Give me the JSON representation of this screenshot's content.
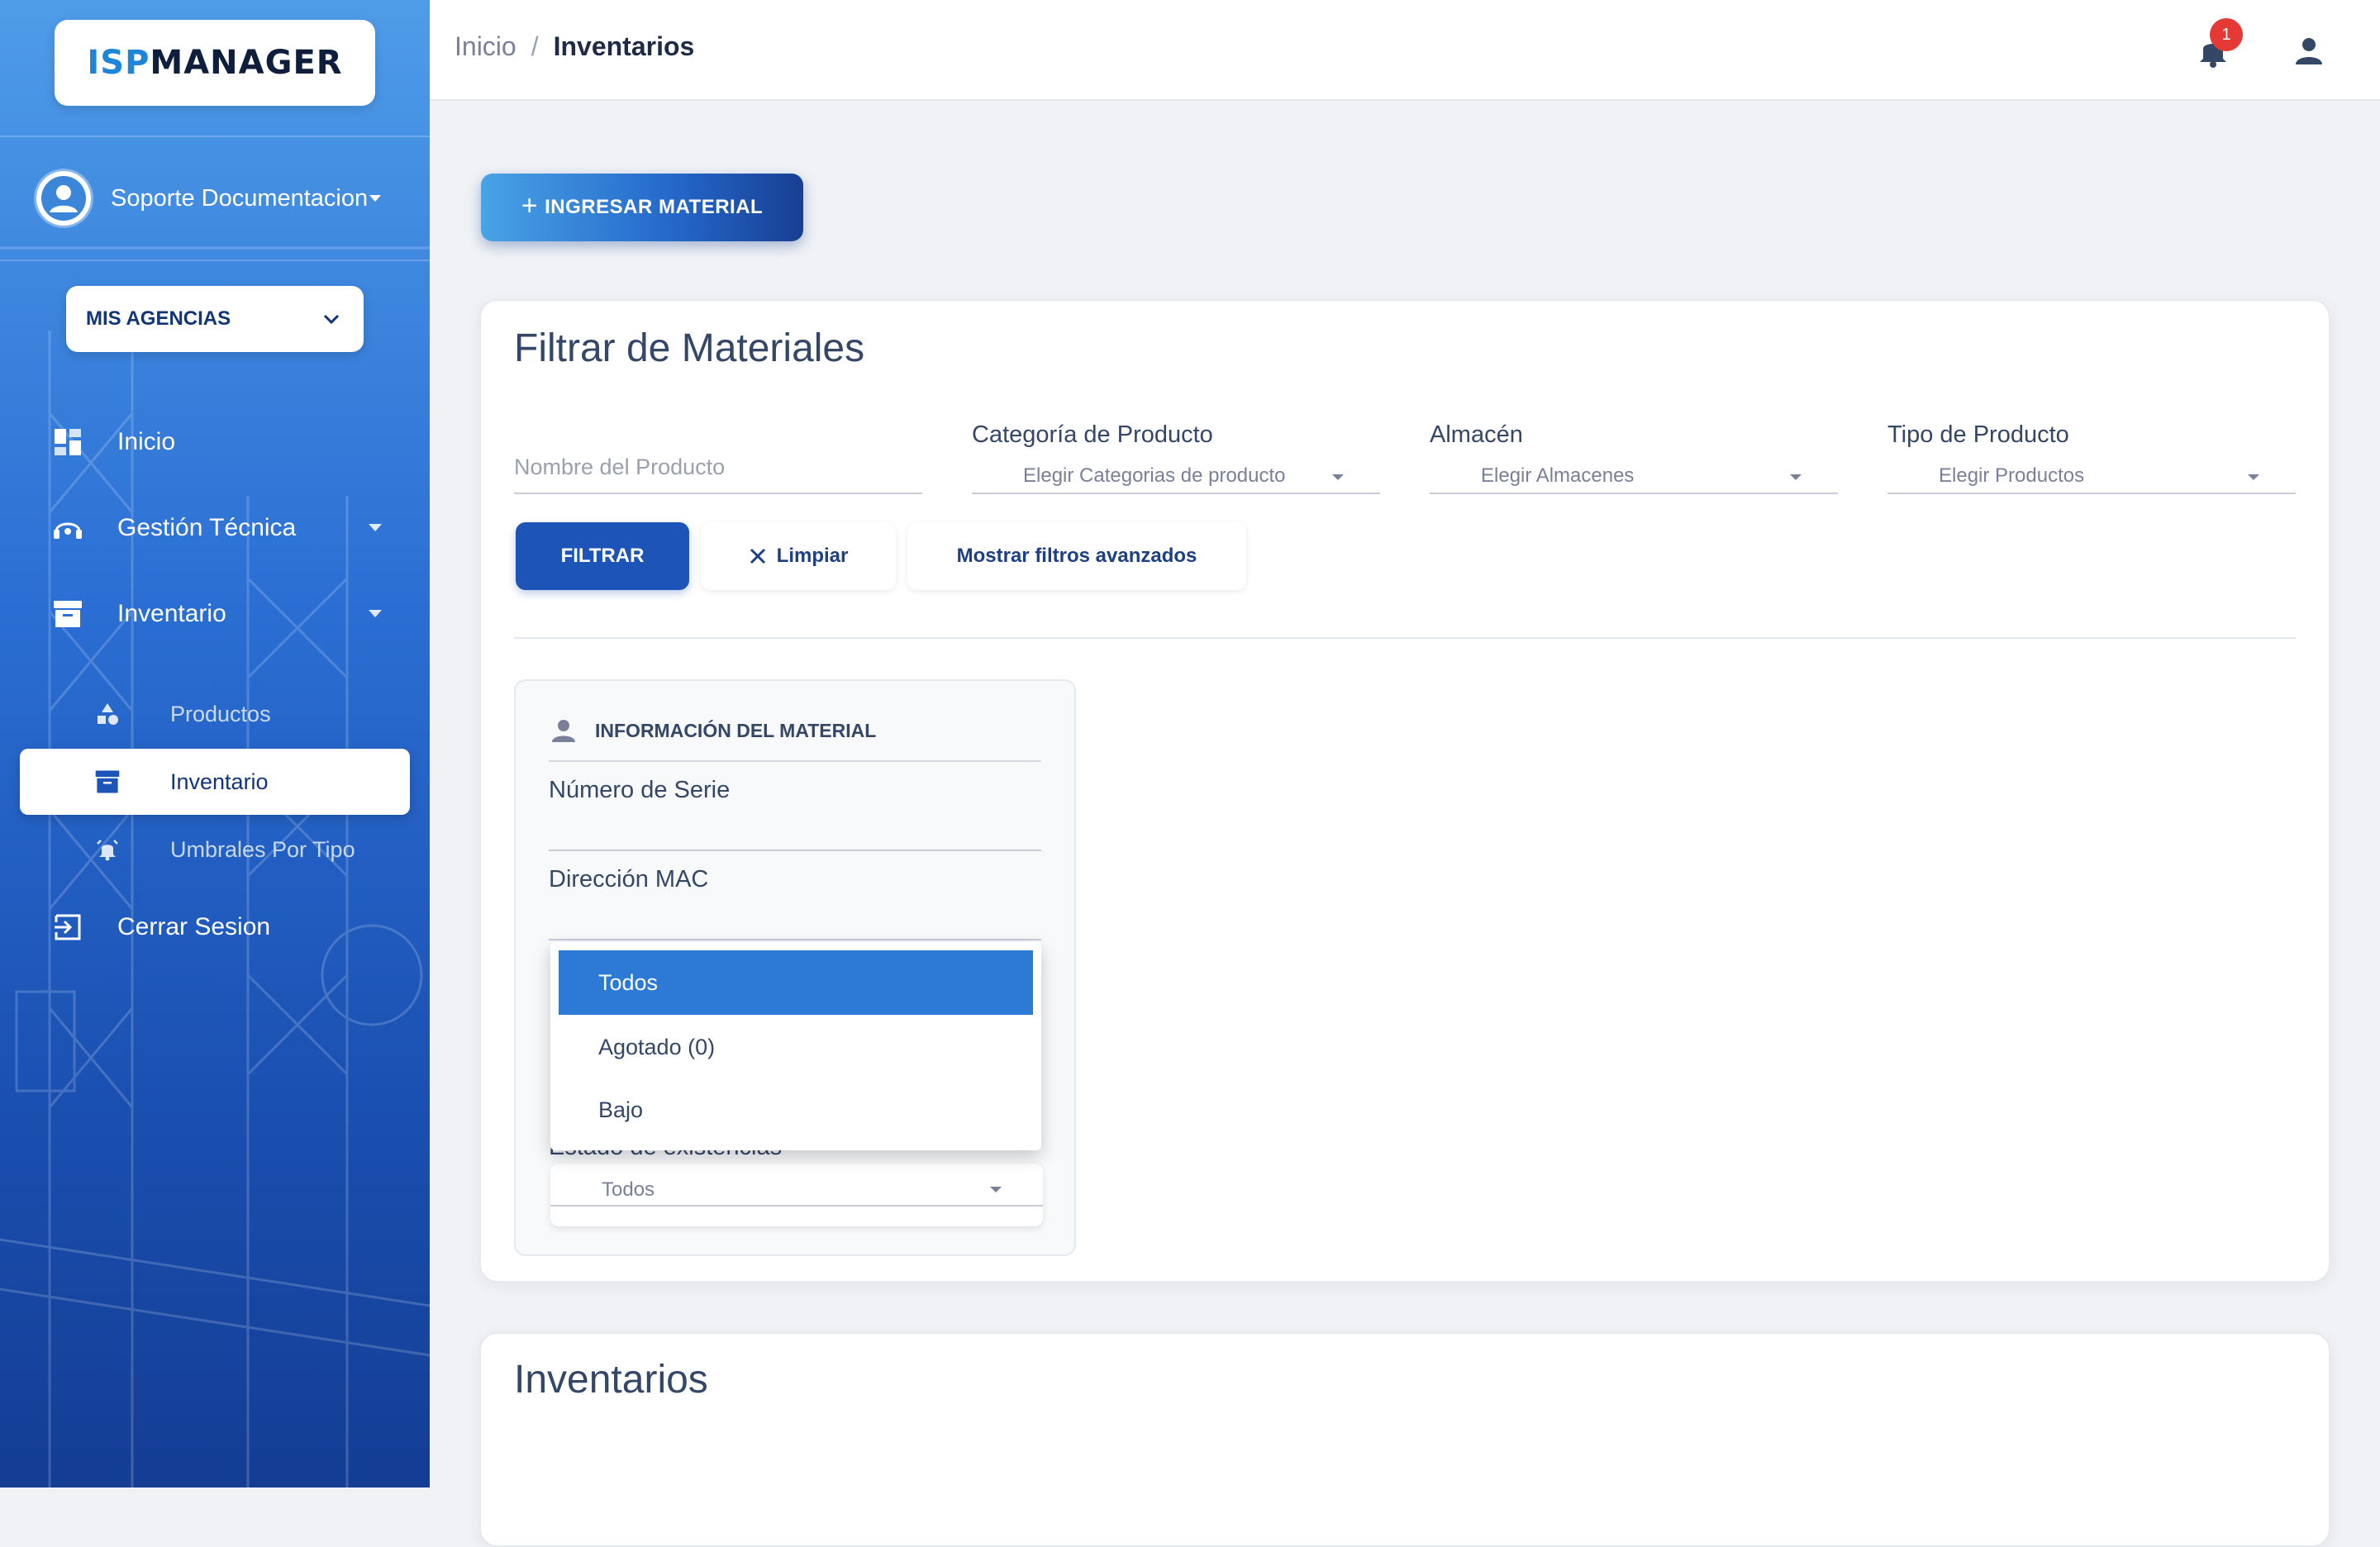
{
  "brand": {
    "logo_part1": "ISP",
    "logo_part2": "MANAGER"
  },
  "user": {
    "name": "Soporte Documentacion"
  },
  "agencies": {
    "label": "MIS AGENCIAS"
  },
  "nav": {
    "inicio": "Inicio",
    "gestion": "Gestión Técnica",
    "inventario": "Inventario",
    "sub_productos": "Productos",
    "sub_inventario": "Inventario",
    "sub_umbrales": "Umbrales Por Tipo",
    "cerrar": "Cerrar Sesion"
  },
  "topbar": {
    "breadcrumb_home": "Inicio",
    "breadcrumb_sep": "/",
    "breadcrumb_current": "Inventarios",
    "notification_count": "1"
  },
  "actions": {
    "ingresar_label": "INGRESAR MATERIAL"
  },
  "filter": {
    "title": "Filtrar de Materiales",
    "nombre_placeholder": "Nombre del Producto",
    "categoria_label": "Categoría de Producto",
    "categoria_value": "Elegir Categorias de producto",
    "almacen_label": "Almacén",
    "almacen_value": "Elegir Almacenes",
    "tipo_label": "Tipo de Producto",
    "tipo_value": "Elegir Productos",
    "btn_filtrar": "FILTRAR",
    "btn_limpiar": "Limpiar",
    "btn_avanzados": "Mostrar filtros avanzados"
  },
  "info": {
    "header": "INFORMACIÓN DEL MATERIAL",
    "serie_label": "Número de Serie",
    "mac_label": "Dirección MAC",
    "estado_label": "Estado de existencias",
    "estado_value": "Todos",
    "options": [
      "Todos",
      "Agotado (0)",
      "Bajo"
    ]
  },
  "inventarios": {
    "title": "Inventarios"
  },
  "colors": {
    "primary": "#1d54b8",
    "sidebar_top": "#4f9ce8",
    "sidebar_bottom": "#143d94",
    "badge": "#e53935"
  }
}
